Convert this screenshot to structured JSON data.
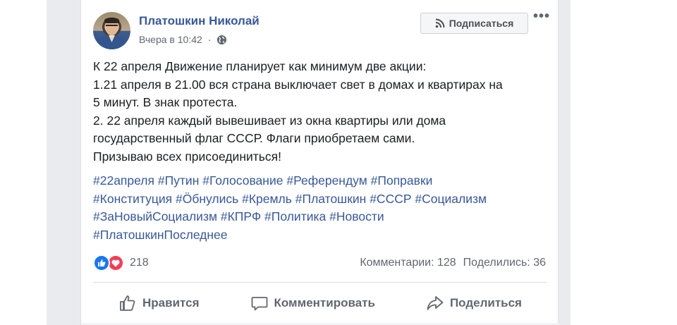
{
  "post": {
    "author": "Платошкин Николай",
    "time": "Вчера в 10:42",
    "subscribe_label": "Подписаться",
    "more_label": "•••",
    "lines": [
      "К 22 апреля Движение планирует как минимум две акции:",
      "1.21 апреля в 21.00 вся страна выключает свет в домах и квартирах на",
      "5 минут. В знак протеста.",
      "2. 22 апреля каждый вывешивает из окна квартиры или дома",
      "государственный флаг СССР. Флаги приобретаем сами.",
      "Призываю всех присоединиться!"
    ],
    "tags": [
      [
        "#22апреля",
        "#Путин",
        "#Голосование",
        "#Референдум",
        "#Поправки"
      ],
      [
        "#Конституция",
        "#Ӧбнулись",
        "#Кремль",
        "#Платошкин",
        "#СССР",
        "#Социализм"
      ],
      [
        "#ЗаНовыйСоциализм",
        "#КПРФ",
        "#Политика",
        "#Новости"
      ],
      [
        "#ПлатошкинПоследнее"
      ]
    ]
  },
  "reactions": {
    "count": "218",
    "comments": "Комментарии: 128",
    "shares": "Поделились: 36"
  },
  "actions": {
    "like": "Нравится",
    "comment": "Комментировать",
    "share": "Поделиться"
  },
  "colors": {
    "link": "#385898",
    "like_blue": "#1877f2",
    "love_red": "#f33e58",
    "secondary_text": "#606770"
  },
  "icons": [
    "globe-icon",
    "rss-icon",
    "more-icon",
    "like-reaction-icon",
    "love-reaction-icon",
    "thumbs-up-icon",
    "comment-icon",
    "share-icon"
  ]
}
